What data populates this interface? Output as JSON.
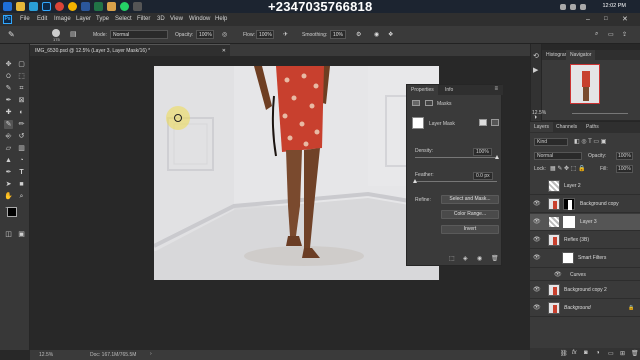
{
  "taskbar": {
    "phone_overlay": "+2347035766818",
    "clock": "12:02 PM"
  },
  "menu": {
    "app_badge": "Ps",
    "items": [
      "File",
      "Edit",
      "Image",
      "Layer",
      "Type",
      "Select",
      "Filter",
      "3D",
      "View",
      "Window",
      "Help"
    ]
  },
  "options": {
    "mode_label": "Mode:",
    "mode_value": "Normal",
    "opacity_label": "Opacity:",
    "opacity_value": "100%",
    "flow_label": "Flow:",
    "flow_value": "100%",
    "smoothing_label": "Smoothing:",
    "smoothing_value": "10%",
    "brush_size": "175"
  },
  "document": {
    "tab_title": "IMG_6530.psd @ 12.5% (Layer 3, Layer Mask/16) *"
  },
  "status": {
    "zoom": "12.5%",
    "doc": "Doc: 167.1M/765.5M"
  },
  "properties": {
    "tabs": [
      "Properties",
      "Info"
    ],
    "section": "Masks",
    "mask_label": "Layer Mask",
    "density_label": "Density:",
    "density_value": "100%",
    "density_level": 1.0,
    "feather_label": "Feather:",
    "feather_value": "0.0 px",
    "feather_level": 0.0,
    "refine_label": "Refine:",
    "select_and_mask": "Select and Mask...",
    "color_range": "Color Range...",
    "invert": "Invert"
  },
  "navigator": {
    "tabs": [
      "Histogram",
      "Navigator"
    ],
    "zoom": "12.5%"
  },
  "layers": {
    "tabs": [
      "Layers",
      "Channels",
      "Paths"
    ],
    "kind_label": "Kind",
    "blend_mode": "Normal",
    "opacity_label": "Opacity:",
    "opacity_value": "100%",
    "lock_label": "Lock:",
    "fill_label": "Fill:",
    "fill_value": "100%",
    "rows": [
      {
        "name": "Layer 2",
        "visible": false,
        "thumb": "transparent"
      },
      {
        "name": "Background copy",
        "visible": true,
        "thumb": "photo-mask"
      },
      {
        "name": "Layer 3",
        "visible": true,
        "thumb": "transparent-mask",
        "selected": true
      },
      {
        "name": "Reflex (3B)",
        "visible": true,
        "thumb": "smart"
      },
      {
        "name": "Smart Filters",
        "visible": true,
        "thumb": "white"
      },
      {
        "name": "Curves",
        "visible": true,
        "thumb": "none"
      },
      {
        "name": "Background copy 2",
        "visible": true,
        "thumb": "photo"
      },
      {
        "name": "Background",
        "visible": true,
        "thumb": "photo"
      }
    ]
  },
  "colors": {
    "accent": "#2d8cd9",
    "panel": "#3a3a3a",
    "canvas_bg": "#282828",
    "dress": "#c8402e",
    "skin": "#7a4a2e"
  }
}
